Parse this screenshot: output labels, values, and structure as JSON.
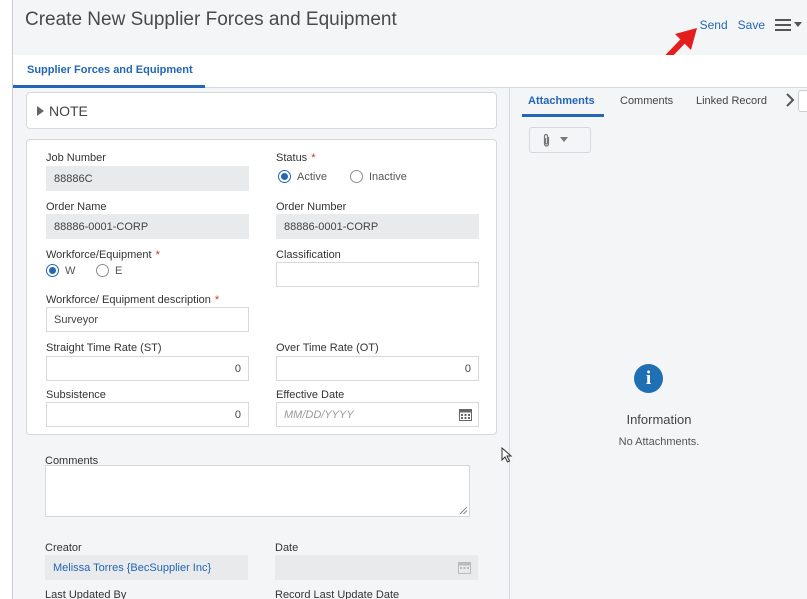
{
  "header": {
    "title": "Create New Supplier Forces and Equipment",
    "send_label": "Send",
    "save_label": "Save"
  },
  "main_tab": {
    "label": "Supplier Forces and Equipment"
  },
  "note": {
    "label": "NOTE"
  },
  "form": {
    "job_number": {
      "label": "Job Number",
      "value": "88886C"
    },
    "status": {
      "label": "Status",
      "required": "*",
      "options": [
        "Active",
        "Inactive"
      ],
      "selected": "Active"
    },
    "order_name": {
      "label": "Order Name",
      "value": "88886-0001-CORP"
    },
    "order_number": {
      "label": "Order Number",
      "value": "88886-0001-CORP"
    },
    "workforce_equipment": {
      "label": "Workforce/Equipment",
      "required": "*",
      "options": [
        "W",
        "E"
      ],
      "selected": "W"
    },
    "classification": {
      "label": "Classification",
      "value": ""
    },
    "workforce_description": {
      "label": "Workforce/ Equipment description",
      "required": "*",
      "value": "Surveyor"
    },
    "straight_time_rate": {
      "label": "Straight Time Rate (ST)",
      "value": "0"
    },
    "over_time_rate": {
      "label": "Over Time Rate (OT)",
      "value": "0"
    },
    "subsistence": {
      "label": "Subsistence",
      "value": "0"
    },
    "effective_date": {
      "label": "Effective Date",
      "placeholder": "MM/DD/YYYY"
    },
    "comments": {
      "label": "Comments",
      "value": ""
    },
    "creator": {
      "label": "Creator",
      "value": "Melissa Torres {BecSupplier Inc}"
    },
    "date": {
      "label": "Date",
      "value": ""
    },
    "last_updated_by": {
      "label": "Last Updated By"
    },
    "record_last_update_date": {
      "label": "Record Last Update Date"
    }
  },
  "right_panel": {
    "tabs": [
      "Attachments",
      "Comments",
      "Linked Record"
    ],
    "active_tab": "Attachments",
    "info_title": "Information",
    "info_message": "No Attachments."
  },
  "icons": {
    "menu": "hamburger-icon",
    "note_toggle": "triangle-right-icon",
    "attach": "paperclip-icon",
    "calendar": "calendar-icon",
    "info": "info-icon",
    "annotation": "red-arrow"
  },
  "colors": {
    "accent": "#2466b5",
    "required": "#c0392b",
    "info": "#1f6fb3",
    "annotation_arrow": "#e41e1e"
  }
}
